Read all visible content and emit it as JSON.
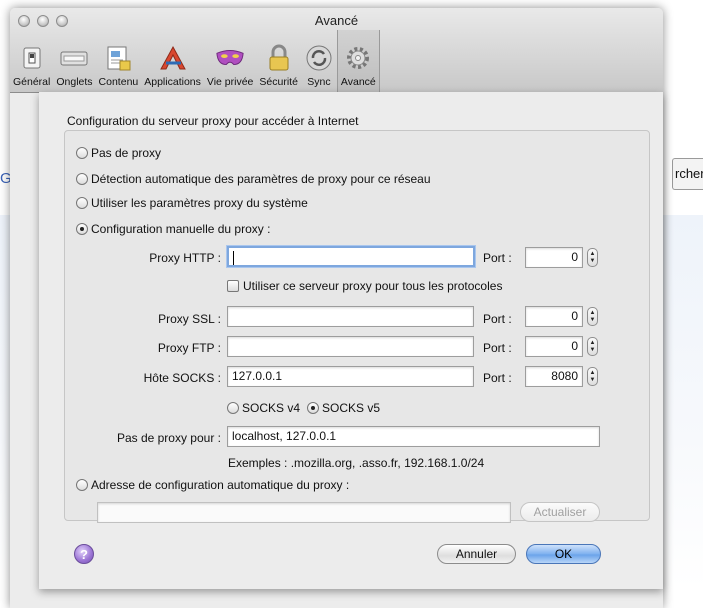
{
  "window": {
    "title": "Avancé",
    "toolbar": [
      {
        "label": "Général",
        "icon": "switch-icon",
        "active": false
      },
      {
        "label": "Onglets",
        "icon": "tabs-icon",
        "active": false
      },
      {
        "label": "Contenu",
        "icon": "content-icon",
        "active": false
      },
      {
        "label": "Applications",
        "icon": "applications-icon",
        "active": false
      },
      {
        "label": "Vie privée",
        "icon": "privacy-mask-icon",
        "active": false
      },
      {
        "label": "Sécurité",
        "icon": "padlock-icon",
        "active": false
      },
      {
        "label": "Sync",
        "icon": "sync-icon",
        "active": false
      },
      {
        "label": "Avancé",
        "icon": "gear-icon",
        "active": true
      }
    ]
  },
  "background": {
    "left_text": "G",
    "right_button": "rcher"
  },
  "proxy": {
    "heading": "Configuration du serveur proxy pour accéder à Internet",
    "options": {
      "none": "Pas de proxy",
      "auto_detect": "Détection automatique des paramètres de proxy pour ce réseau",
      "system": "Utiliser les paramètres proxy du système",
      "manual": "Configuration manuelle du proxy :",
      "auto_url": "Adresse de configuration automatique du proxy :"
    },
    "selected_option": "manual",
    "http": {
      "label": "Proxy HTTP :",
      "value": "",
      "port_label": "Port :",
      "port": "0"
    },
    "use_for_all": "Utiliser ce serveur proxy pour tous les protocoles",
    "ssl": {
      "label": "Proxy SSL :",
      "value": "",
      "port_label": "Port :",
      "port": "0"
    },
    "ftp": {
      "label": "Proxy FTP :",
      "value": "",
      "port_label": "Port :",
      "port": "0"
    },
    "socks": {
      "label": "Hôte SOCKS :",
      "value": "127.0.0.1",
      "port_label": "Port :",
      "port": "8080"
    },
    "socks_v4": "SOCKS v4",
    "socks_v5": "SOCKS v5",
    "socks_selected": "v5",
    "no_proxy": {
      "label": "Pas de proxy pour :",
      "value": "localhost, 127.0.0.1"
    },
    "examples": "Exemples : .mozilla.org, .asso.fr, 192.168.1.0/24",
    "auto_url_value": "",
    "reload_button": "Actualiser"
  },
  "buttons": {
    "help": "?",
    "cancel": "Annuler",
    "ok": "OK"
  },
  "colors": {
    "accent": "#6aa3ea",
    "help_purple": "#9a73d4"
  }
}
